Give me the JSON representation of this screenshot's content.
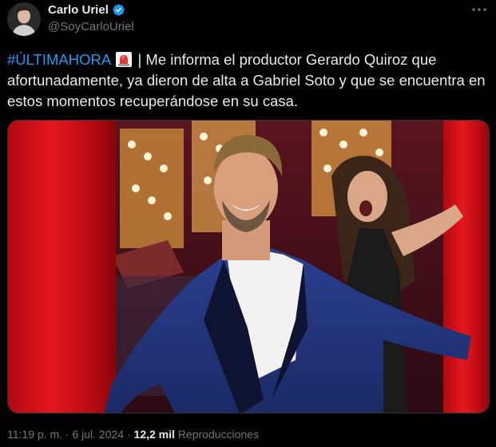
{
  "author": {
    "name": "Carlo Uriel",
    "handle": "@SoyCarloUriel",
    "verified": true,
    "avatar_icon": "profile-avatar"
  },
  "tweet": {
    "hashtag": "#ÚLTIMAHORA",
    "emoji": "siren-emoji",
    "body": "| Me informa el productor Gerardo Quiroz que afortunadamente, ya dieron de alta a Gabriel Soto y que se encuentra en estos momentos recuperándose en su casa."
  },
  "media": {
    "image_icon": "photo-man-in-blue-suit-and-surprised-woman"
  },
  "meta": {
    "time": "11:19 p. m.",
    "separator1": "·",
    "date": "6 jul. 2024",
    "separator2": "·",
    "views_count": "12,2 mil",
    "views_label": "Reproducciones"
  },
  "colors": {
    "background": "#000000",
    "text": "#e7e9ea",
    "secondary": "#71767b",
    "accent": "#1d9bf0"
  }
}
